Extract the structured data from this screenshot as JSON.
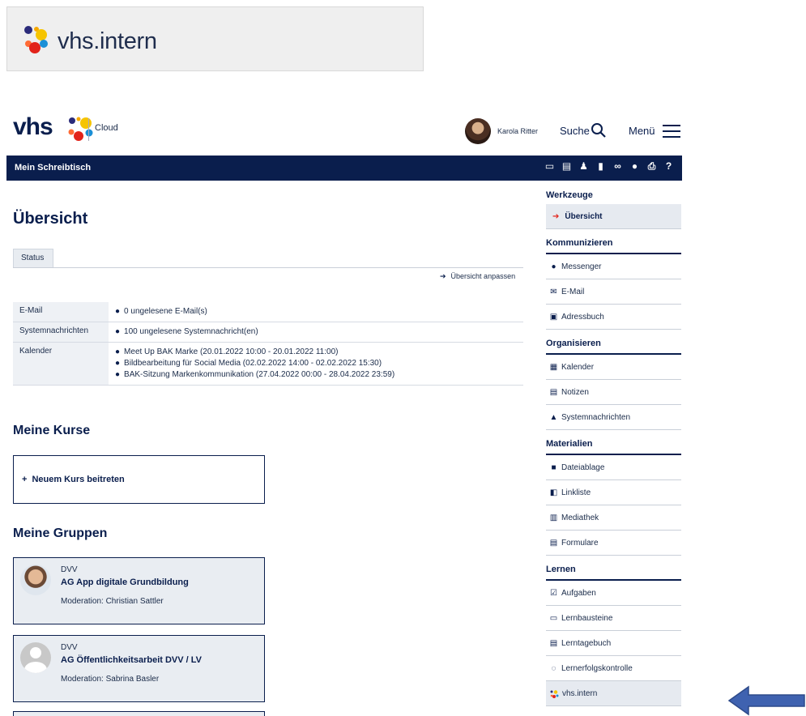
{
  "banner": {
    "title": "vhs.intern",
    "logo_icon": "vhs-dots-logo"
  },
  "header": {
    "brand": "vhs",
    "cloud_label": "Cloud",
    "user_name": "Karola Ritter",
    "search_label": "Suche",
    "menu_label": "Menü"
  },
  "navbar": {
    "title": "Mein Schreibtisch",
    "toolbar_icons": [
      "messenger-icon",
      "calendar-icon",
      "user-icon",
      "bookmark-icon",
      "link-icon",
      "location-icon",
      "print-icon",
      "help-icon"
    ]
  },
  "main": {
    "title": "Übersicht",
    "tab": "Status",
    "customize_link": "Übersicht anpassen",
    "status_rows": [
      {
        "label": "E-Mail",
        "lines": [
          "0 ungelesene E-Mail(s)"
        ]
      },
      {
        "label": "Systemnachrichten",
        "lines": [
          "100 ungelesene Systemnachricht(en)"
        ]
      },
      {
        "label": "Kalender",
        "lines": [
          "Meet Up BAK Marke (20.01.2022 10:00 - 20.01.2022 11:00)",
          "Bildbearbeitung für Social Media (02.02.2022 14:00 - 02.02.2022 15:30)",
          "BAK-Sitzung Markenkommunikation (27.04.2022 00:00 - 28.04.2022 23:59)"
        ]
      }
    ],
    "courses_title": "Meine Kurse",
    "join_course": "Neuem Kurs beitreten",
    "groups_title": "Meine Gruppen",
    "groups": [
      {
        "org": "DVV",
        "name": "AG App digitale Grundbildung",
        "moderation": "Moderation: Christian Sattler"
      },
      {
        "org": "DVV",
        "name": "AG Öffentlichkeitsarbeit DVV / LV",
        "moderation": "Moderation: Sabrina Basler"
      }
    ]
  },
  "sidebar": {
    "tools_title": "Werkzeuge",
    "overview": "Übersicht",
    "sections": [
      {
        "title": "Kommunizieren",
        "items": [
          {
            "label": "Messenger",
            "icon": "messenger-icon"
          },
          {
            "label": "E-Mail",
            "icon": "mail-icon"
          },
          {
            "label": "Adressbuch",
            "icon": "addressbook-icon"
          }
        ]
      },
      {
        "title": "Organisieren",
        "items": [
          {
            "label": "Kalender",
            "icon": "calendar-icon"
          },
          {
            "label": "Notizen",
            "icon": "notes-icon"
          },
          {
            "label": "Systemnachrichten",
            "icon": "warning-icon"
          }
        ]
      },
      {
        "title": "Materialien",
        "items": [
          {
            "label": "Dateiablage",
            "icon": "folder-icon"
          },
          {
            "label": "Linkliste",
            "icon": "linklist-icon"
          },
          {
            "label": "Mediathek",
            "icon": "media-icon"
          },
          {
            "label": "Formulare",
            "icon": "form-icon"
          }
        ]
      },
      {
        "title": "Lernen",
        "items": [
          {
            "label": "Aufgaben",
            "icon": "tasks-icon"
          },
          {
            "label": "Lernbausteine",
            "icon": "learning-modules-icon"
          },
          {
            "label": "Lerntagebuch",
            "icon": "learning-diary-icon"
          },
          {
            "label": "Lernerfolgskontrolle",
            "icon": "progress-icon"
          },
          {
            "label": "vhs.intern",
            "icon": "vhs-dots-logo"
          }
        ]
      }
    ]
  },
  "colors": {
    "navy": "#0a1e4d",
    "accent_red": "#e2231a",
    "arrow_blue": "#3f62b0"
  }
}
